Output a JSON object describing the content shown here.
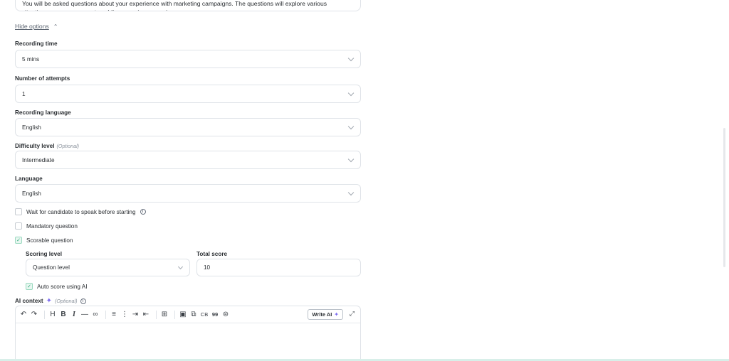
{
  "description": {
    "text": "You will be asked questions about your experience with marketing campaigns. The questions will explore various situations you may encounter while managing campaigns."
  },
  "options_toggle": {
    "label": "Hide options"
  },
  "fields": {
    "recording_time": {
      "label": "Recording time",
      "value": "5 mins"
    },
    "attempts": {
      "label": "Number of attempts",
      "value": "1"
    },
    "recording_language": {
      "label": "Recording language",
      "value": "English"
    },
    "difficulty": {
      "label": "Difficulty level",
      "optional": "(Optional)",
      "value": "Intermediate"
    },
    "language": {
      "label": "Language",
      "value": "English"
    }
  },
  "checkboxes": {
    "wait": {
      "label": "Wait for candidate to speak before starting",
      "checked": false
    },
    "mandatory": {
      "label": "Mandatory question",
      "checked": false
    },
    "scorable": {
      "label": "Scorable question",
      "checked": true
    },
    "auto_score": {
      "label": "Auto score using AI",
      "checked": true
    }
  },
  "scoring": {
    "level_label": "Scoring level",
    "level_value": "Question level",
    "total_label": "Total score",
    "total_value": "10"
  },
  "ai_context": {
    "label": "AI context",
    "optional": "(Optional)",
    "write_ai_label": "Write AI",
    "toolbar": {
      "cb_label": "CB",
      "quote_label": "99"
    }
  },
  "colors": {
    "accent": "#7c6cf0",
    "check": "#2aa876",
    "border": "#dfe3e8"
  }
}
